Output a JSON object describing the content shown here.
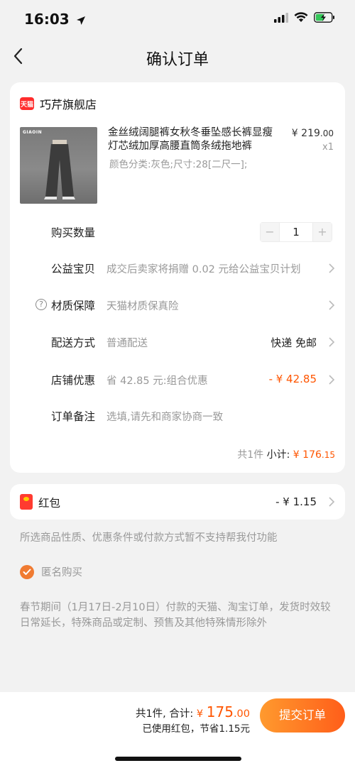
{
  "status_bar": {
    "time": "16:03"
  },
  "nav": {
    "title": "确认订单"
  },
  "shop": {
    "badge": "天猫",
    "name": "巧芹旗舰店"
  },
  "product": {
    "image_brand": "GIAOIN",
    "title": "金丝绒阔腿裤女秋冬垂坠感长裤显瘦灯芯绒加厚高腰直筒条绒拖地裤",
    "spec": "颜色分类:灰色;尺寸:28[二尺一];",
    "price_symbol": "¥",
    "price_int": "219",
    "price_dec": ".00",
    "qty_mult": "x1"
  },
  "rows": {
    "quantity": {
      "label": "购买数量",
      "minus": "−",
      "value": "1",
      "plus": "+"
    },
    "charity": {
      "label": "公益宝贝",
      "value": "成交后卖家将捐赠 0.02 元给公益宝贝计划"
    },
    "material": {
      "label": "材质保障",
      "help": "?",
      "value": "天猫材质保真险"
    },
    "delivery": {
      "label": "配送方式",
      "value": "普通配送",
      "right": "快递 免邮"
    },
    "discount": {
      "label": "店铺优惠",
      "value": "省 42.85 元:组合优惠",
      "right": "- ¥ 42.85"
    },
    "remark": {
      "label": "订单备注",
      "value": "选填,请先和商家协商一致"
    }
  },
  "subtotal": {
    "count": "共1件",
    "label": "小计:",
    "symbol": "¥",
    "int": "176",
    "dec": ".15"
  },
  "hongbao": {
    "label": "红包",
    "amount": "- ¥ 1.15"
  },
  "notice": "所选商品性质、优惠条件或付款方式暂不支持帮我付功能",
  "anonymous": {
    "label": "匿名购买",
    "checked": true
  },
  "holiday_notice": "春节期间（1月17日-2月10日）付款的天猫、淘宝订单，发货时效较日常延长，特殊商品或定制、预售及其他特殊情形除外",
  "footer": {
    "count": "共1件,",
    "total_label": "合计:",
    "symbol": "¥",
    "total_int": "175",
    "total_dec": ".00",
    "saved": "已使用红包，节省1.15元",
    "submit": "提交订单"
  },
  "colors": {
    "accent": "#ff5500",
    "button_start": "#ff9a2e",
    "button_end": "#ff5e1a",
    "tmall_red": "#ff2d2d"
  }
}
